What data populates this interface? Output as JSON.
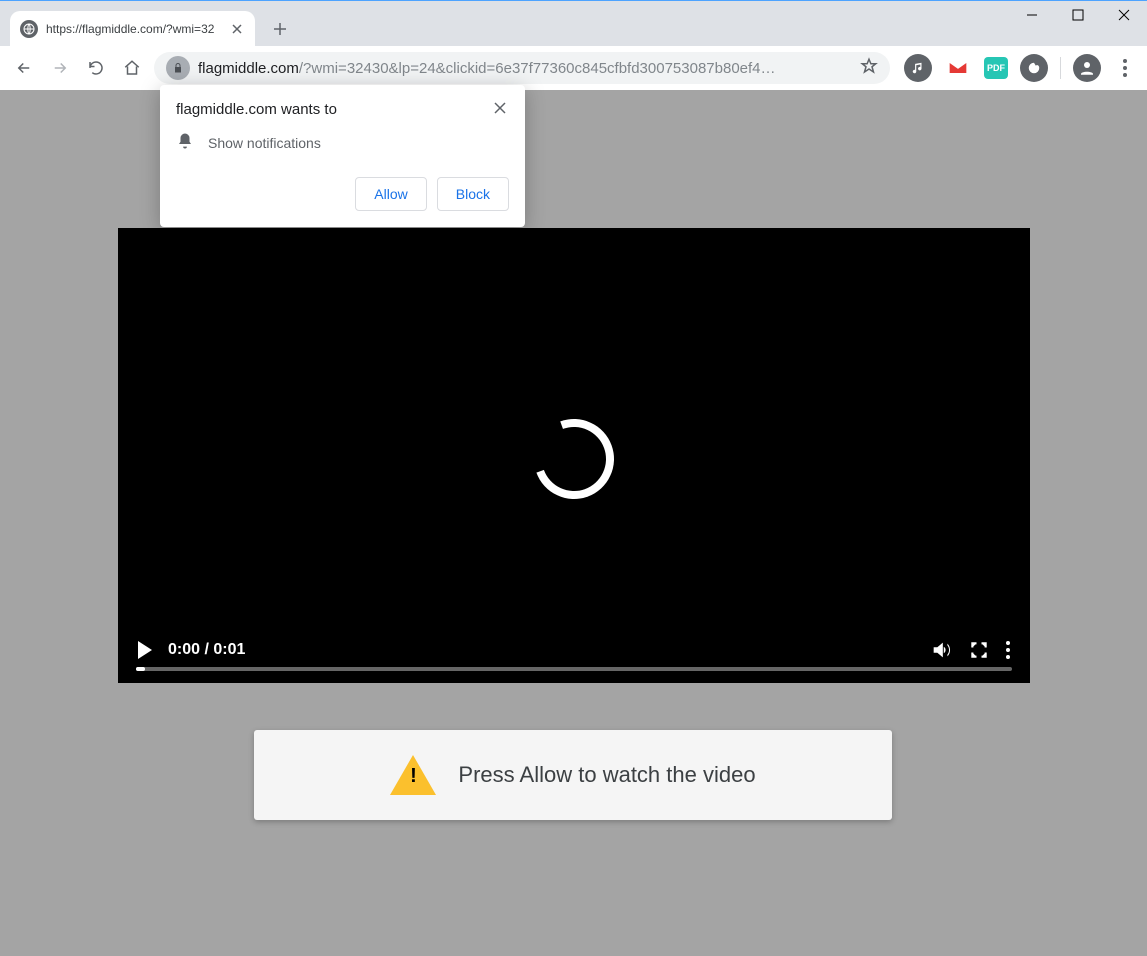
{
  "window": {
    "tab_title": "https://flagmiddle.com/?wmi=32"
  },
  "toolbar": {
    "url_dark": "flagmiddle.com",
    "url_rest": "/?wmi=32430&lp=24&clickid=6e37f77360c845cfbfd300753087b80ef4…"
  },
  "permission": {
    "title": "flagmiddle.com wants to",
    "row": "Show notifications",
    "allow": "Allow",
    "block": "Block"
  },
  "video": {
    "time": "0:00 / 0:01"
  },
  "banner": {
    "text": "Press Allow to watch the video"
  }
}
